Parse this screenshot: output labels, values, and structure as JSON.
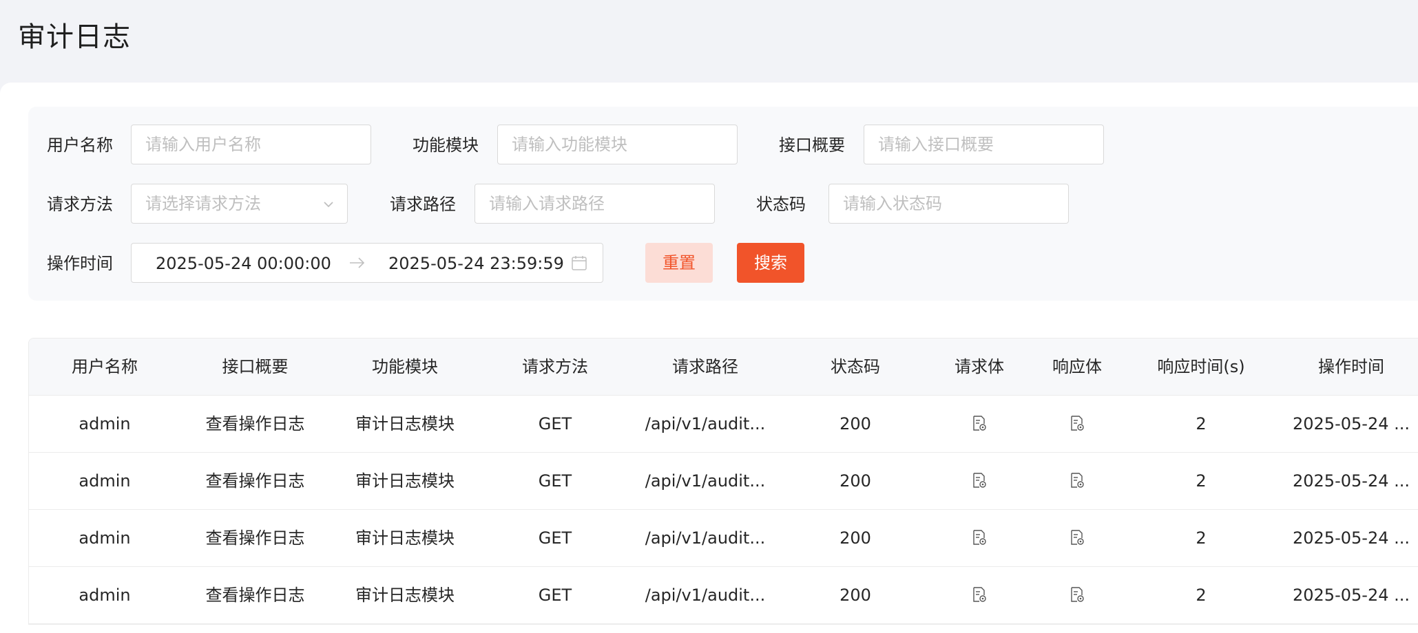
{
  "page": {
    "title": "审计日志"
  },
  "filters": {
    "username": {
      "label": "用户名称",
      "placeholder": "请输入用户名称"
    },
    "module": {
      "label": "功能模块",
      "placeholder": "请输入功能模块"
    },
    "summary": {
      "label": "接口概要",
      "placeholder": "请输入接口概要"
    },
    "method": {
      "label": "请求方法",
      "placeholder": "请选择请求方法"
    },
    "path": {
      "label": "请求路径",
      "placeholder": "请输入请求路径"
    },
    "status": {
      "label": "状态码",
      "placeholder": "请输入状态码"
    },
    "time": {
      "label": "操作时间",
      "start": "2025-05-24 00:00:00",
      "end": "2025-05-24 23:59:59"
    },
    "reset_label": "重置",
    "search_label": "搜索"
  },
  "table": {
    "columns": [
      "用户名称",
      "接口概要",
      "功能模块",
      "请求方法",
      "请求路径",
      "状态码",
      "请求体",
      "响应体",
      "响应时间(s)",
      "操作时间"
    ],
    "rows": [
      {
        "user": "admin",
        "summary": "查看操作日志",
        "module": "审计日志模块",
        "method": "GET",
        "path": "/api/v1/audit...",
        "status": "200",
        "response_time": "2",
        "time": "2025-05-24 ..."
      },
      {
        "user": "admin",
        "summary": "查看操作日志",
        "module": "审计日志模块",
        "method": "GET",
        "path": "/api/v1/audit...",
        "status": "200",
        "response_time": "2",
        "time": "2025-05-24 ..."
      },
      {
        "user": "admin",
        "summary": "查看操作日志",
        "module": "审计日志模块",
        "method": "GET",
        "path": "/api/v1/audit...",
        "status": "200",
        "response_time": "2",
        "time": "2025-05-24 ..."
      },
      {
        "user": "admin",
        "summary": "查看操作日志",
        "module": "审计日志模块",
        "method": "GET",
        "path": "/api/v1/audit...",
        "status": "200",
        "response_time": "2",
        "time": "2025-05-24 ..."
      }
    ]
  },
  "icons": {
    "request_body": "document-view-icon",
    "response_body": "document-view-icon",
    "select_arrow": "chevron-down-icon",
    "range_separator": "arrow-right-icon",
    "calendar": "calendar-icon"
  },
  "colors": {
    "accent": "#f1542a",
    "accent_light": "#fcddd6"
  }
}
